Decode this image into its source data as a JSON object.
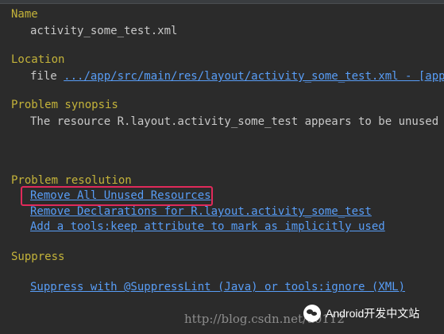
{
  "name": {
    "title": "Name",
    "value": "activity_some_test.xml"
  },
  "location": {
    "title": "Location",
    "prefix": "file ",
    "link": ".../app/src/main/res/layout/activity_some_test.xml - [app]"
  },
  "problem_synopsis": {
    "title": "Problem synopsis",
    "text": "The resource R.layout.activity_some_test appears to be unused (at"
  },
  "problem_resolution": {
    "title": "Problem resolution",
    "actions": [
      "Remove All Unused Resources",
      "Remove Declarations for R.layout.activity_some_test",
      "Add a tools:keep attribute to mark as implicitly used"
    ]
  },
  "suppress": {
    "title": "Suppress",
    "action": "Suppress with @SuppressLint (Java) or tools:ignore (XML)"
  },
  "watermark": {
    "text": "http://blog.csdn.net/u0112"
  },
  "badge": {
    "label": "Android开发中文站",
    "icon": "wechat-icon"
  },
  "colors": {
    "background": "#2b2b2b",
    "section_title": "#c4b33a",
    "body_text": "#c9c9c9",
    "link": "#589df6",
    "highlight": "#e02a5a"
  }
}
